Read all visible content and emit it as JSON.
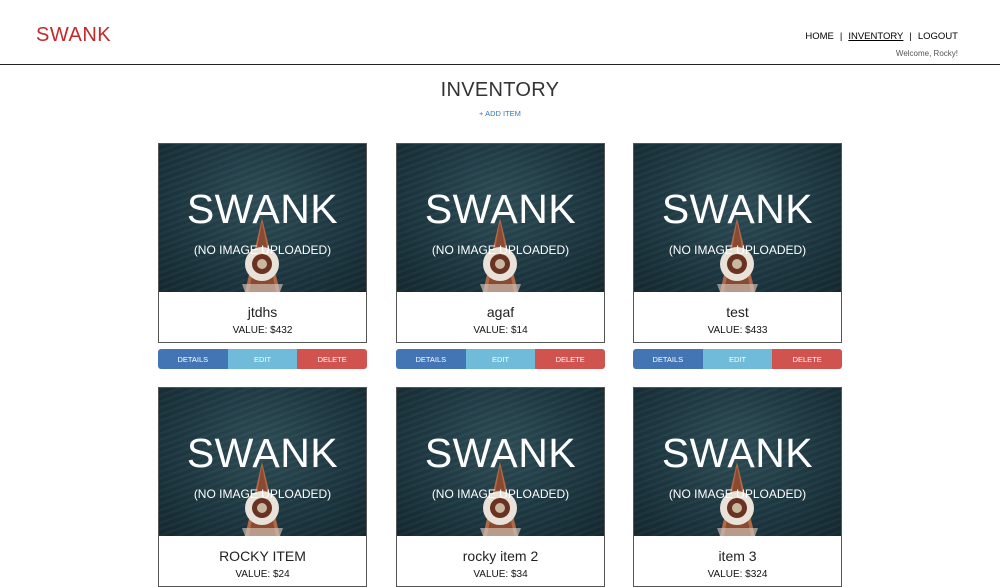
{
  "header": {
    "logo": "SWANK",
    "nav": {
      "home": "HOME",
      "inventory": "INVENTORY",
      "logout": "LOGOUT",
      "separator": "|"
    },
    "welcome": "Welcome, Rocky!"
  },
  "page": {
    "title": "INVENTORY",
    "add_item": "+ ADD ITEM"
  },
  "placeholder": {
    "brand": "SWANK",
    "note": "(NO IMAGE UPLOADED)"
  },
  "buttons": {
    "details": "DETAILS",
    "edit": "EDIT",
    "delete": "DELETE"
  },
  "items": [
    {
      "name": "jtdhs",
      "value": "VALUE: $432"
    },
    {
      "name": "agaf",
      "value": "VALUE: $14"
    },
    {
      "name": "test",
      "value": "VALUE: $433"
    },
    {
      "name": "ROCKY ITEM",
      "value": "VALUE: $24"
    },
    {
      "name": "rocky item 2",
      "value": "VALUE: $34"
    },
    {
      "name": "item 3",
      "value": "VALUE: $324"
    }
  ],
  "colors": {
    "logo": "#c62828",
    "details": "#4375b5",
    "edit": "#6fbbd9",
    "delete": "#d0534f",
    "link": "#337ab7"
  }
}
